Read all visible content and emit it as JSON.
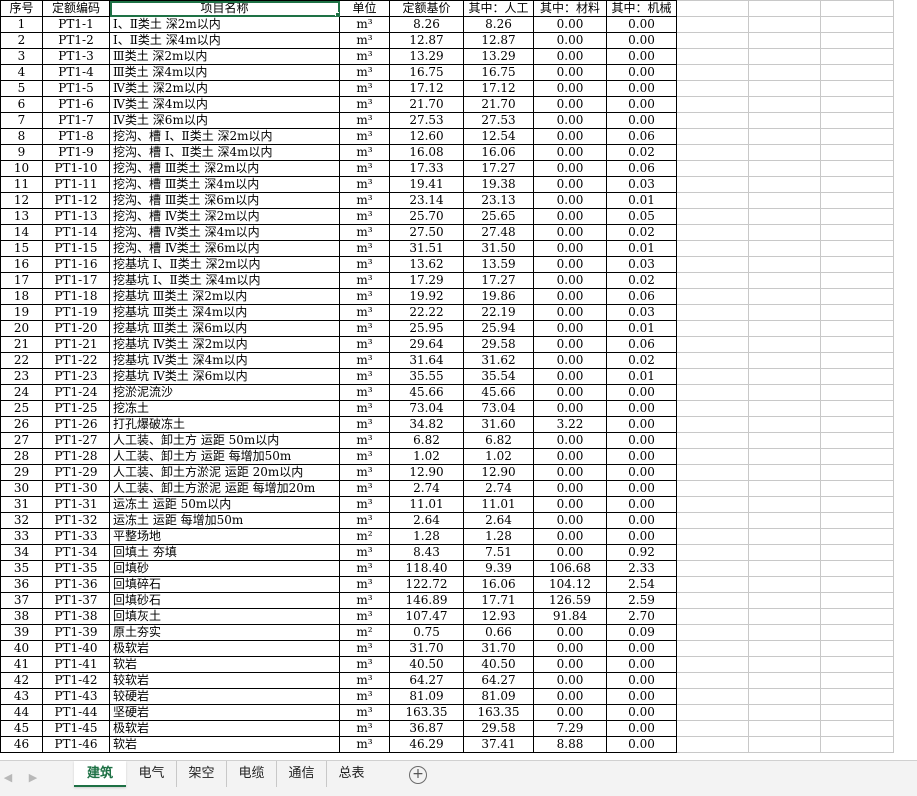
{
  "headers": [
    "序号",
    "定额编码",
    "项目名称",
    "单位",
    "定额基价",
    "其中：人工",
    "其中：材料",
    "其中：机械"
  ],
  "rows": [
    [
      "1",
      "PT1-1",
      "Ⅰ、Ⅱ类土 深2m以内",
      "m³",
      "8.26",
      "8.26",
      "0.00",
      "0.00"
    ],
    [
      "2",
      "PT1-2",
      "Ⅰ、Ⅱ类土 深4m以内",
      "m³",
      "12.87",
      "12.87",
      "0.00",
      "0.00"
    ],
    [
      "3",
      "PT1-3",
      "Ⅲ类土 深2m以内",
      "m³",
      "13.29",
      "13.29",
      "0.00",
      "0.00"
    ],
    [
      "4",
      "PT1-4",
      "Ⅲ类土 深4m以内",
      "m³",
      "16.75",
      "16.75",
      "0.00",
      "0.00"
    ],
    [
      "5",
      "PT1-5",
      "Ⅳ类土 深2m以内",
      "m³",
      "17.12",
      "17.12",
      "0.00",
      "0.00"
    ],
    [
      "6",
      "PT1-6",
      "Ⅳ类土 深4m以内",
      "m³",
      "21.70",
      "21.70",
      "0.00",
      "0.00"
    ],
    [
      "7",
      "PT1-7",
      "Ⅳ类土 深6m以内",
      "m³",
      "27.53",
      "27.53",
      "0.00",
      "0.00"
    ],
    [
      "8",
      "PT1-8",
      "挖沟、槽 Ⅰ、Ⅱ类土 深2m以内",
      "m³",
      "12.60",
      "12.54",
      "0.00",
      "0.06"
    ],
    [
      "9",
      "PT1-9",
      "挖沟、槽 Ⅰ、Ⅱ类土 深4m以内",
      "m³",
      "16.08",
      "16.06",
      "0.00",
      "0.02"
    ],
    [
      "10",
      "PT1-10",
      "挖沟、槽 Ⅲ类土 深2m以内",
      "m³",
      "17.33",
      "17.27",
      "0.00",
      "0.06"
    ],
    [
      "11",
      "PT1-11",
      "挖沟、槽 Ⅲ类土 深4m以内",
      "m³",
      "19.41",
      "19.38",
      "0.00",
      "0.03"
    ],
    [
      "12",
      "PT1-12",
      "挖沟、槽 Ⅲ类土 深6m以内",
      "m³",
      "23.14",
      "23.13",
      "0.00",
      "0.01"
    ],
    [
      "13",
      "PT1-13",
      "挖沟、槽 Ⅳ类土 深2m以内",
      "m³",
      "25.70",
      "25.65",
      "0.00",
      "0.05"
    ],
    [
      "14",
      "PT1-14",
      "挖沟、槽 Ⅳ类土 深4m以内",
      "m³",
      "27.50",
      "27.48",
      "0.00",
      "0.02"
    ],
    [
      "15",
      "PT1-15",
      "挖沟、槽 Ⅳ类土 深6m以内",
      "m³",
      "31.51",
      "31.50",
      "0.00",
      "0.01"
    ],
    [
      "16",
      "PT1-16",
      "挖基坑 Ⅰ、Ⅱ类土 深2m以内",
      "m³",
      "13.62",
      "13.59",
      "0.00",
      "0.03"
    ],
    [
      "17",
      "PT1-17",
      "挖基坑 Ⅰ、Ⅱ类土 深4m以内",
      "m³",
      "17.29",
      "17.27",
      "0.00",
      "0.02"
    ],
    [
      "18",
      "PT1-18",
      "挖基坑 Ⅲ类土 深2m以内",
      "m³",
      "19.92",
      "19.86",
      "0.00",
      "0.06"
    ],
    [
      "19",
      "PT1-19",
      "挖基坑 Ⅲ类土 深4m以内",
      "m³",
      "22.22",
      "22.19",
      "0.00",
      "0.03"
    ],
    [
      "20",
      "PT1-20",
      "挖基坑 Ⅲ类土 深6m以内",
      "m³",
      "25.95",
      "25.94",
      "0.00",
      "0.01"
    ],
    [
      "21",
      "PT1-21",
      "挖基坑 Ⅳ类土 深2m以内",
      "m³",
      "29.64",
      "29.58",
      "0.00",
      "0.06"
    ],
    [
      "22",
      "PT1-22",
      "挖基坑 Ⅳ类土 深4m以内",
      "m³",
      "31.64",
      "31.62",
      "0.00",
      "0.02"
    ],
    [
      "23",
      "PT1-23",
      "挖基坑 Ⅳ类土 深6m以内",
      "m³",
      "35.55",
      "35.54",
      "0.00",
      "0.01"
    ],
    [
      "24",
      "PT1-24",
      "挖淤泥流沙",
      "m³",
      "45.66",
      "45.66",
      "0.00",
      "0.00"
    ],
    [
      "25",
      "PT1-25",
      "挖冻土",
      "m³",
      "73.04",
      "73.04",
      "0.00",
      "0.00"
    ],
    [
      "26",
      "PT1-26",
      "打孔爆破冻土",
      "m³",
      "34.82",
      "31.60",
      "3.22",
      "0.00"
    ],
    [
      "27",
      "PT1-27",
      "人工装、卸土方 运距 50m以内",
      "m³",
      "6.82",
      "6.82",
      "0.00",
      "0.00"
    ],
    [
      "28",
      "PT1-28",
      "人工装、卸土方 运距 每增加50m",
      "m³",
      "1.02",
      "1.02",
      "0.00",
      "0.00"
    ],
    [
      "29",
      "PT1-29",
      "人工装、卸土方淤泥 运距 20m以内",
      "m³",
      "12.90",
      "12.90",
      "0.00",
      "0.00"
    ],
    [
      "30",
      "PT1-30",
      "人工装、卸土方淤泥 运距 每增加20m",
      "m³",
      "2.74",
      "2.74",
      "0.00",
      "0.00"
    ],
    [
      "31",
      "PT1-31",
      "运冻土 运距 50m以内",
      "m³",
      "11.01",
      "11.01",
      "0.00",
      "0.00"
    ],
    [
      "32",
      "PT1-32",
      "运冻土 运距 每增加50m",
      "m³",
      "2.64",
      "2.64",
      "0.00",
      "0.00"
    ],
    [
      "33",
      "PT1-33",
      "平整场地",
      "m²",
      "1.28",
      "1.28",
      "0.00",
      "0.00"
    ],
    [
      "34",
      "PT1-34",
      "回填土 夯填",
      "m³",
      "8.43",
      "7.51",
      "0.00",
      "0.92"
    ],
    [
      "35",
      "PT1-35",
      "回填砂",
      "m³",
      "118.40",
      "9.39",
      "106.68",
      "2.33"
    ],
    [
      "36",
      "PT1-36",
      "回填碎石",
      "m³",
      "122.72",
      "16.06",
      "104.12",
      "2.54"
    ],
    [
      "37",
      "PT1-37",
      "回填砂石",
      "m³",
      "146.89",
      "17.71",
      "126.59",
      "2.59"
    ],
    [
      "38",
      "PT1-38",
      "回填灰土",
      "m³",
      "107.47",
      "12.93",
      "91.84",
      "2.70"
    ],
    [
      "39",
      "PT1-39",
      "原土夯实",
      "m²",
      "0.75",
      "0.66",
      "0.00",
      "0.09"
    ],
    [
      "40",
      "PT1-40",
      "极软岩",
      "m³",
      "31.70",
      "31.70",
      "0.00",
      "0.00"
    ],
    [
      "41",
      "PT1-41",
      "软岩",
      "m³",
      "40.50",
      "40.50",
      "0.00",
      "0.00"
    ],
    [
      "42",
      "PT1-42",
      "较软岩",
      "m³",
      "64.27",
      "64.27",
      "0.00",
      "0.00"
    ],
    [
      "43",
      "PT1-43",
      "较硬岩",
      "m³",
      "81.09",
      "81.09",
      "0.00",
      "0.00"
    ],
    [
      "44",
      "PT1-44",
      "坚硬岩",
      "m³",
      "163.35",
      "163.35",
      "0.00",
      "0.00"
    ],
    [
      "45",
      "PT1-45",
      "极软岩",
      "m³",
      "36.87",
      "29.58",
      "7.29",
      "0.00"
    ],
    [
      "46",
      "PT1-46",
      "软岩",
      "m³",
      "46.29",
      "37.41",
      "8.88",
      "0.00"
    ]
  ],
  "tabs": [
    "建筑",
    "电气",
    "架空",
    "电缆",
    "通信",
    "总表"
  ],
  "active_tab": "建筑",
  "accent_color": "#1e7145",
  "icons": {
    "nav_prev": "chevron-left-icon",
    "nav_next": "chevron-right-icon",
    "add_sheet": "plus-circle-icon"
  }
}
